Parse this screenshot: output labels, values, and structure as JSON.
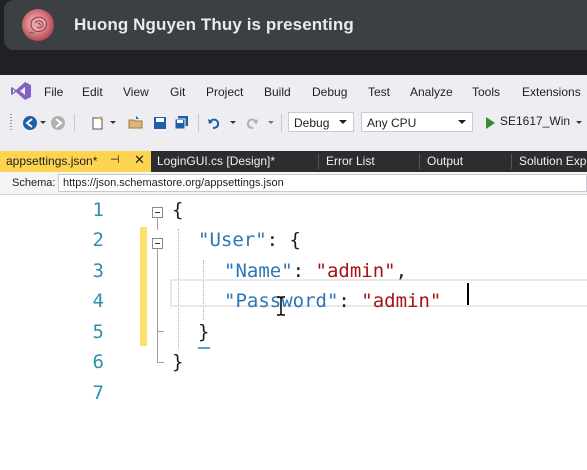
{
  "banner": {
    "presenter_text": "Huong Nguyen Thuy is presenting"
  },
  "menu": {
    "items": [
      "File",
      "Edit",
      "View",
      "Git",
      "Project",
      "Build",
      "Debug",
      "Test",
      "Analyze",
      "Tools",
      "Extensions"
    ]
  },
  "toolbar": {
    "configuration": "Debug",
    "platform": "Any CPU",
    "run_target": "SE1617_Win"
  },
  "tabs": [
    {
      "label": "appsettings.json*",
      "active": true
    },
    {
      "label": "LoginGUI.cs [Design]*",
      "active": false
    },
    {
      "label": "Error List",
      "active": false
    },
    {
      "label": "Output",
      "active": false
    },
    {
      "label": "Solution Exp",
      "active": false
    }
  ],
  "schema": {
    "label": "Schema:",
    "value": "https://json.schemastore.org/appsettings.json"
  },
  "editor": {
    "line_numbers": [
      "1",
      "2",
      "3",
      "4",
      "5",
      "6",
      "7"
    ],
    "lines": [
      {
        "text": "{"
      },
      {
        "key": "\"User\"",
        "rest": ": {"
      },
      {
        "key": "\"Name\"",
        "sep": ": ",
        "value": "\"admin\"",
        "tail": ","
      },
      {
        "key": "\"Password\"",
        "sep": ": ",
        "value": "\"admin\"",
        "tail": ""
      },
      {
        "text": "}"
      },
      {
        "text": "}"
      },
      {
        "text": ""
      }
    ]
  },
  "colors": {
    "active_tab": "#fcd450",
    "json_key": "#2e75b6",
    "json_string": "#a31515",
    "line_number": "#2b91af"
  }
}
